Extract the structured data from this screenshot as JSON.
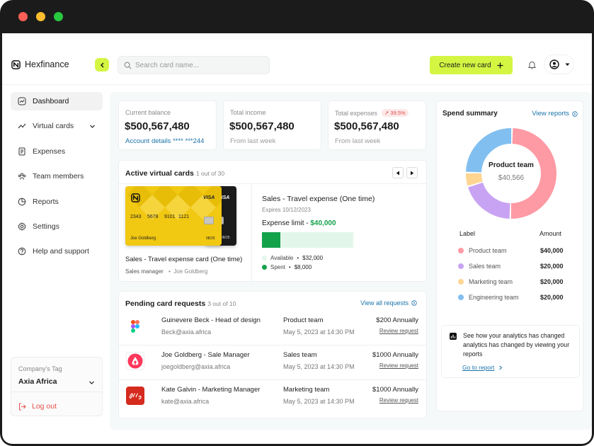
{
  "app": {
    "name": "Hexfinance"
  },
  "search": {
    "placeholder": "Search card name..."
  },
  "header": {
    "create_label": "Create new card",
    "create_icon": "plus-icon"
  },
  "sidebar": {
    "items": [
      {
        "label": "Dashboard",
        "icon": "chart-line-icon",
        "active": true
      },
      {
        "label": "Virtual cards",
        "icon": "trend-icon"
      },
      {
        "label": "Expenses",
        "icon": "receipt-icon"
      },
      {
        "label": "Team members",
        "icon": "team-icon"
      },
      {
        "label": "Reports",
        "icon": "pie-icon"
      },
      {
        "label": "Settings",
        "icon": "gear-icon"
      },
      {
        "label": "Help and support",
        "icon": "help-icon"
      }
    ],
    "company_tag_label": "Company's Tag",
    "company_tag_value": "Axia Africa",
    "logout": "Log out"
  },
  "stats": [
    {
      "label": "Current balance",
      "value": "$500,567,480",
      "sub": "Account details **** ***244"
    },
    {
      "label": "Total income",
      "value": "$500,567,480",
      "sub": "From last week"
    },
    {
      "label": "Total expenses",
      "badge": "↗ 39.5%",
      "value": "$500,567,480",
      "sub": "From last week"
    }
  ],
  "virtual_cards": {
    "title": "Active virtual cards",
    "count": "1 out of 30",
    "card_number": "2343 5678 9101 1121",
    "card_num_parts": [
      "2343",
      "5678",
      "9101",
      "1121"
    ],
    "holder": "Joe Goldberg",
    "expiry": "08/25",
    "brand": "VISA",
    "caption": "Sales - Travel expense card (One time)",
    "role": "Sales manager",
    "owner": "Joe Goldberg",
    "detail_title": "Sales - Travel expense (One time)",
    "detail_expires": "Expires 10/12/2023",
    "limit_label": "Expense limit - ",
    "limit_value": "$40,000",
    "available_label": "Available",
    "available_value": "$32,000",
    "spent_label": "Spent",
    "spent_value": "$8,000",
    "spent_fraction": 0.2,
    "colors": {
      "available": "#e3f6ea",
      "spent": "#13a24a"
    }
  },
  "pending": {
    "title": "Pending card requests",
    "count": "3 out of 10",
    "view_all": "View all requests",
    "rows": [
      {
        "icon": "figma-icon",
        "name": "Guinevere Beck - Head of design",
        "email": "Beck@axia.africa",
        "team": "Product team",
        "date": "May 5, 2023 at 14:30 PM",
        "amount": "$200 Annually",
        "review": "Review request"
      },
      {
        "icon": "airbnb-icon",
        "name": "Joe Goldberg - Sale Manager",
        "email": "joegoldberg@axia.africa",
        "team": "Sales team",
        "date": "May 5, 2023 at 14:30 PM",
        "amount": "$1000 Annually",
        "review": "Review request"
      },
      {
        "icon": "lilly-icon",
        "name": "Kate Galvin - Marketing Manager",
        "email": "kate@axia.africa",
        "team": "Marketing team",
        "date": "May 5, 2023 at 14:30 PM",
        "amount": "$1000 Annually",
        "review": "Review request"
      }
    ]
  },
  "spend": {
    "title": "Spend summary",
    "view_reports": "View reports",
    "center_label": "Product team",
    "center_value": "$40,566",
    "col_label": "Label",
    "col_amount": "Amount",
    "legend": [
      {
        "label": "Product team",
        "amount": "$40,000",
        "color": "#fe9aa4"
      },
      {
        "label": "Sales team",
        "amount": "$20,000",
        "color": "#c9a3f3"
      },
      {
        "label": "Marketing team",
        "amount": "$20,000",
        "color": "#ffd592"
      },
      {
        "label": "Engineering team",
        "amount": "$20,000",
        "color": "#81bff0"
      }
    ],
    "analytics_text": "See how your analytics has changed analytics has changed by viewing your reports",
    "goto": "Go to report"
  },
  "chart_data": {
    "type": "pie",
    "donut": true,
    "categories": [
      "Product team",
      "Sales team",
      "Marketing team",
      "Engineering team"
    ],
    "values": [
      0.5,
      0.2,
      0.05,
      0.25
    ],
    "colors": [
      "#fe9aa4",
      "#c9a3f3",
      "#ffd592",
      "#81bff0"
    ]
  },
  "colors": {
    "accent": "#d4f542",
    "link": "#1a73a8",
    "danger": "#e8504a"
  }
}
